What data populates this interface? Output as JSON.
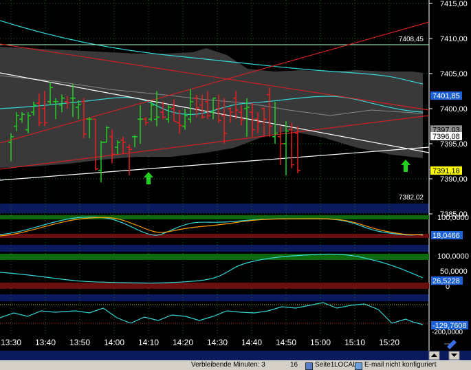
{
  "main_chart": {
    "y_ticks": [
      "7415,00",
      "7410,00",
      "7405,00",
      "7400,00",
      "7395,00",
      "7390,00",
      "7385,00"
    ],
    "y_tick_values": [
      7415,
      7410,
      7405,
      7400,
      7395,
      7390,
      7385
    ],
    "level_labels": {
      "upper": "7408,45",
      "lower": "7382,02"
    },
    "price_tags": [
      {
        "id": "blue",
        "text": "7401,85",
        "bg": "#1d61d6",
        "fg": "#ffffff",
        "value": 7401.85
      },
      {
        "id": "grey",
        "text": "7397,03",
        "bg": "#8f8f8f",
        "fg": "#000000",
        "value": 7397.03
      },
      {
        "id": "white",
        "text": "7396,08",
        "bg": "#ffffff",
        "fg": "#000000",
        "value": 7396.08
      },
      {
        "id": "yellow",
        "text": "7391,18",
        "bg": "#ffff00",
        "fg": "#000000",
        "value": 7391.18
      }
    ]
  },
  "indicator1": {
    "ticks": [
      "100,0000",
      "0"
    ],
    "value_tag": "18,0466"
  },
  "indicator2": {
    "ticks": [
      "100,0000",
      "50,0000",
      "0"
    ],
    "value_tag": "26,5228"
  },
  "indicator3": {
    "ticks": [
      "-200,0000"
    ],
    "value_tag": "-129,7608"
  },
  "time_axis": [
    "13:30",
    "13:40",
    "13:50",
    "14:00",
    "14:10",
    "14:20",
    "14:30",
    "14:40",
    "14:50",
    "15:00",
    "15:10",
    "15:20"
  ],
  "status_bar": {
    "remaining": "Verbleibende Minuten: 3",
    "count": "16",
    "page": "Seite1",
    "mode": "LOCAL",
    "email": "E-mail nicht konfiguriert"
  },
  "colors": {
    "bull": "#22d022",
    "bear": "#e82020",
    "cyan": "#33d6d6",
    "band": "#4a4a4a",
    "regression": "#cc2222",
    "trend": "#ffffff"
  },
  "icons": [
    "draw-tool-icon",
    "scroll-up-arrow-icon",
    "scroll-down-arrow-icon",
    "signal-up-arrow-icon"
  ]
}
